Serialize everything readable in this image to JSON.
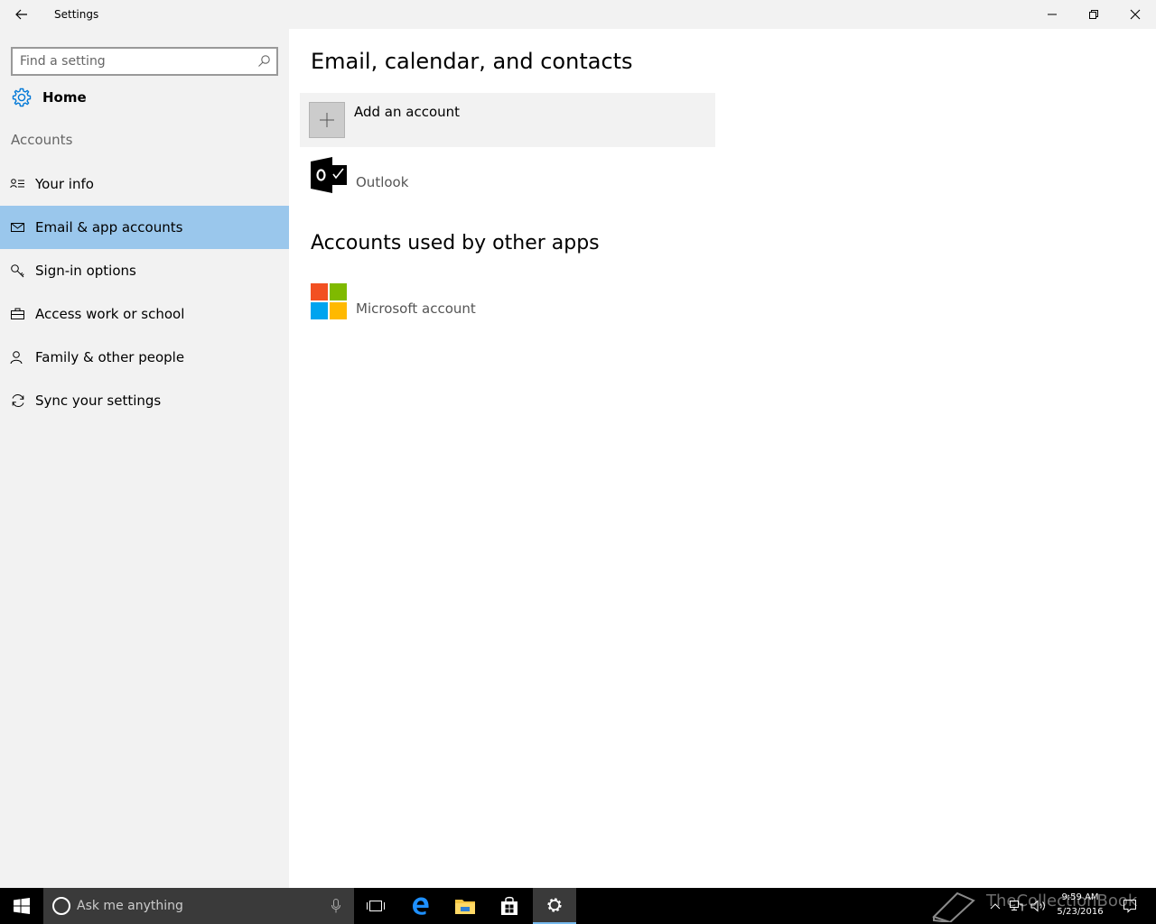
{
  "window": {
    "title": "Settings"
  },
  "sidebar": {
    "search_placeholder": "Find a setting",
    "home_label": "Home",
    "section_header": "Accounts",
    "items": [
      {
        "label": "Your info",
        "icon": "contact-info-icon"
      },
      {
        "label": "Email & app accounts",
        "icon": "mail-icon",
        "selected": true
      },
      {
        "label": "Sign-in options",
        "icon": "key-icon"
      },
      {
        "label": "Access work or school",
        "icon": "briefcase-icon"
      },
      {
        "label": "Family & other people",
        "icon": "person-icon"
      },
      {
        "label": "Sync your settings",
        "icon": "sync-icon"
      }
    ]
  },
  "main": {
    "title": "Email, calendar, and contacts",
    "add_account_label": "Add an account",
    "email_accounts": [
      {
        "label": "Outlook",
        "icon": "outlook-icon"
      }
    ],
    "other_apps_title": "Accounts used by other apps",
    "other_accounts": [
      {
        "label": "Microsoft account",
        "icon": "microsoft-logo-icon"
      }
    ]
  },
  "taskbar": {
    "search_placeholder": "Ask me anything",
    "time": "9:59 AM",
    "date": "5/23/2016",
    "watermark": "TheCollectionBook"
  },
  "colors": {
    "accent_selected": "#9ac7ec",
    "accent_blue": "#0078d7",
    "sidebar_bg": "#f2f2f2",
    "ms_red": "#f25022",
    "ms_green": "#7fba00",
    "ms_blue": "#00a4ef",
    "ms_yellow": "#ffb900"
  }
}
